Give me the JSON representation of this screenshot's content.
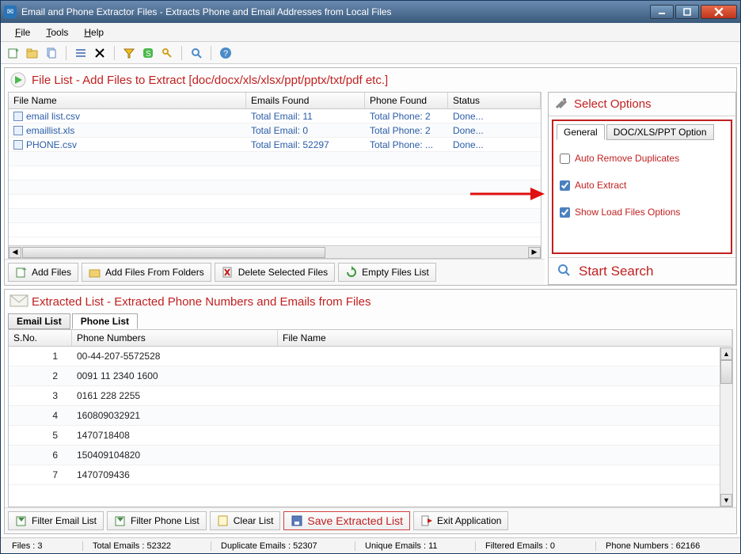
{
  "window": {
    "title": "Email and Phone Extractor Files  -  Extracts Phone and Email Addresses from Local Files"
  },
  "menubar": {
    "items": [
      "File",
      "Tools",
      "Help"
    ]
  },
  "filelist": {
    "title": "File List - Add Files to Extract  [doc/docx/xls/xlsx/ppt/pptx/txt/pdf etc.]",
    "columns": [
      "File Name",
      "Emails Found",
      "Phone Found",
      "Status"
    ],
    "rows": [
      {
        "name": "email list.csv",
        "emails": "Total Email: 11",
        "phone": "Total Phone: 2",
        "status": "Done..."
      },
      {
        "name": "emaillist.xls",
        "emails": "Total Email: 0",
        "phone": "Total Phone: 2",
        "status": "Done..."
      },
      {
        "name": "PHONE.csv",
        "emails": "Total Email: 52297",
        "phone": "Total Phone: ...",
        "status": "Done..."
      }
    ],
    "actions": {
      "add_files": "Add Files",
      "add_folders": "Add Files From Folders",
      "delete_selected": "Delete Selected Files",
      "empty_list": "Empty Files List"
    }
  },
  "options": {
    "title": "Select Options",
    "tabs": [
      "General",
      "DOC/XLS/PPT Option"
    ],
    "checks": {
      "auto_remove": {
        "label": "Auto Remove Duplicates",
        "checked": false
      },
      "auto_extract": {
        "label": "Auto Extract",
        "checked": true
      },
      "show_load": {
        "label": "Show Load Files Options",
        "checked": true
      }
    },
    "start_search": "Start Search"
  },
  "extracted": {
    "title": "Extracted List - Extracted Phone Numbers and Emails from Files",
    "tabs": [
      "Email List",
      "Phone List"
    ],
    "columns": [
      "S.No.",
      "Phone Numbers",
      "File Name"
    ],
    "rows": [
      {
        "sno": "1",
        "phone": "00-44-207-5572528",
        "file": ""
      },
      {
        "sno": "2",
        "phone": "0091 11 2340 1600",
        "file": ""
      },
      {
        "sno": "3",
        "phone": "0161 228 2255",
        "file": ""
      },
      {
        "sno": "4",
        "phone": "160809032921",
        "file": ""
      },
      {
        "sno": "5",
        "phone": "1470718408",
        "file": ""
      },
      {
        "sno": "6",
        "phone": "150409104820",
        "file": ""
      },
      {
        "sno": "7",
        "phone": "1470709436",
        "file": ""
      }
    ],
    "actions": {
      "filter_email": "Filter Email List",
      "filter_phone": "Filter Phone List",
      "clear_list": "Clear List",
      "save_list": "Save Extracted List",
      "exit": "Exit Application"
    }
  },
  "statusbar": {
    "files": "Files :  3",
    "total_emails": "Total Emails :  52322",
    "dup_emails": "Duplicate Emails :  52307",
    "unique_emails": "Unique Emails :  11",
    "filtered_emails": "Filtered Emails :  0",
    "phone_numbers": "Phone Numbers :  62166"
  }
}
